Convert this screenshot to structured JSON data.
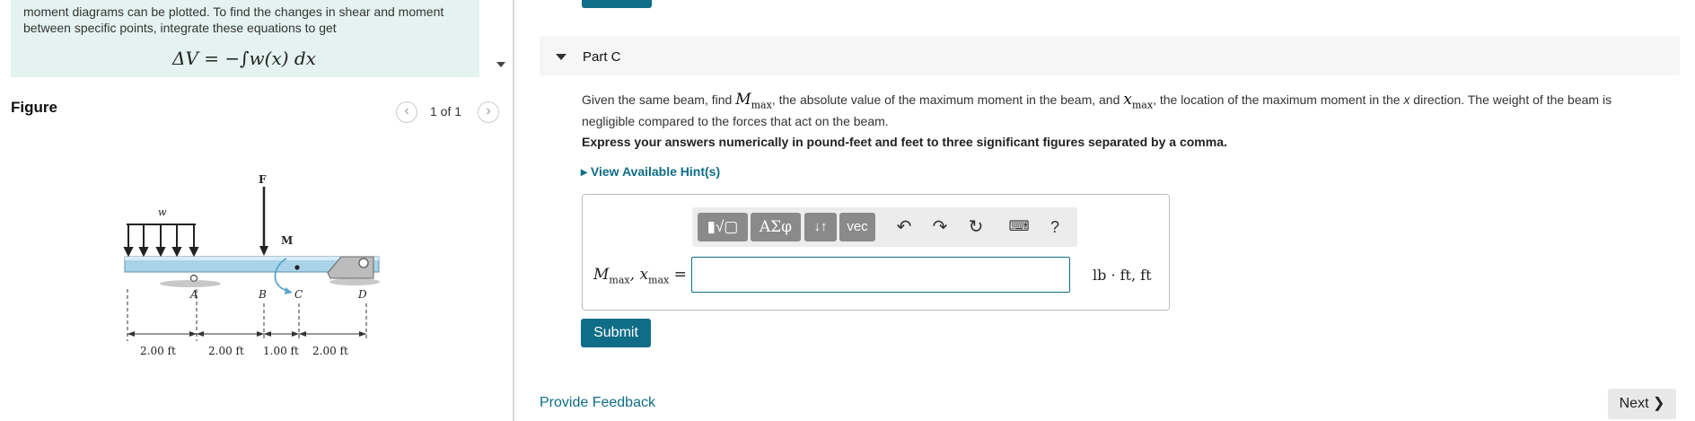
{
  "intro": {
    "line1": "moment diagrams can be plotted.  To find the changes in shear and moment",
    "line2": "between specific points, integrate these equations to get",
    "equation": "ΔV = −∫w(x) dx"
  },
  "figure": {
    "heading": "Figure",
    "pager": "1 of 1",
    "prev_symbol": "‹",
    "next_symbol": "›",
    "labels": {
      "force": "F",
      "load": "w",
      "moment": "M",
      "point_a": "A",
      "point_b": "B",
      "point_c": "C",
      "point_d": "D"
    },
    "dimensions": [
      "2.00 ft",
      "2.00 ft",
      "1.00 ft",
      "2.00 ft"
    ]
  },
  "part": {
    "title": "Part C",
    "question_pre": "Given the same beam, find ",
    "mmax_symbol": "M",
    "mmax_sub": "max",
    "question_mid": ", the absolute value of the maximum moment in the beam, and ",
    "xmax_symbol": "x",
    "xmax_sub": "max",
    "question_post1": ", the location of the maximum moment in the ",
    "question_x": "x",
    "question_post2": " direction. The weight of the beam is negligible compared to the forces that act on the beam.",
    "instruction": "Express your answers numerically in pound-feet and feet to three significant figures separated by a comma.",
    "hint_link": "View Available Hint(s)"
  },
  "toolbar": {
    "template": "▮√▢",
    "greek": "ΑΣφ",
    "arrows": "↓↑",
    "vec": "vec",
    "undo": "↶",
    "redo": "↷",
    "reset": "↻",
    "keyboard": "⌨",
    "help": "?"
  },
  "answer": {
    "label_m": "M",
    "label_m_sub": "max",
    "label_sep": ", ",
    "label_x": "x",
    "label_x_sub": "max",
    "label_eq": " =",
    "value": "",
    "units": "lb · ft, ft"
  },
  "buttons": {
    "submit": "Submit",
    "feedback": "Provide Feedback",
    "next": "Next ❯"
  },
  "colors": {
    "accent": "#0f6d87",
    "intro_bg": "#e4f3f0",
    "beam": "#a9d3e8"
  }
}
